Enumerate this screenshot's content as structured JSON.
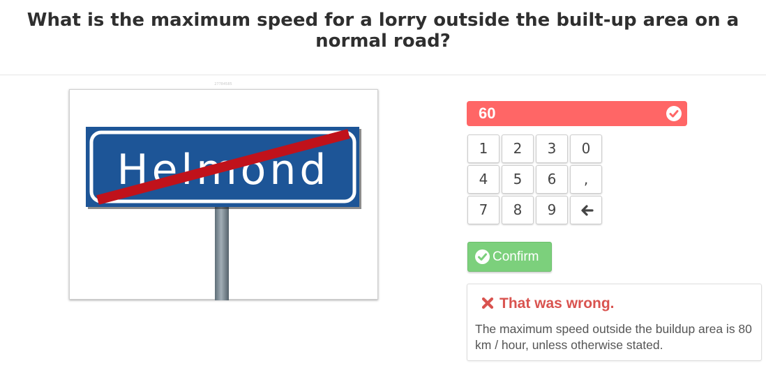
{
  "question": {
    "text": "What is the maximum speed for a lorry outside the built-up area on a normal road?"
  },
  "image": {
    "caption": "27784585",
    "sign_text": "Helmond",
    "sign_color": "#1d5597",
    "strike_color": "#c0121b"
  },
  "answer": {
    "value": "60",
    "state_color": "#ff6666",
    "icon": "check-circle-icon"
  },
  "keypad": {
    "keys": [
      {
        "label": "1",
        "name": "key-1"
      },
      {
        "label": "2",
        "name": "key-2"
      },
      {
        "label": "3",
        "name": "key-3"
      },
      {
        "label": "0",
        "name": "key-0"
      },
      {
        "label": "4",
        "name": "key-4"
      },
      {
        "label": "5",
        "name": "key-5"
      },
      {
        "label": "6",
        "name": "key-6"
      },
      {
        "label": ",",
        "name": "key-comma"
      },
      {
        "label": "7",
        "name": "key-7"
      },
      {
        "label": "8",
        "name": "key-8"
      },
      {
        "label": "9",
        "name": "key-9"
      },
      {
        "label": "",
        "name": "key-backspace",
        "icon": "arrow-left-icon"
      }
    ]
  },
  "confirm": {
    "label": "Confirm",
    "color": "#7cd07c",
    "icon": "check-circle-icon"
  },
  "feedback": {
    "title": "That was wrong.",
    "body": "The maximum speed outside the buildup area is 80 km / hour, unless otherwise stated.",
    "title_color": "#d9534f",
    "icon": "x-icon"
  }
}
